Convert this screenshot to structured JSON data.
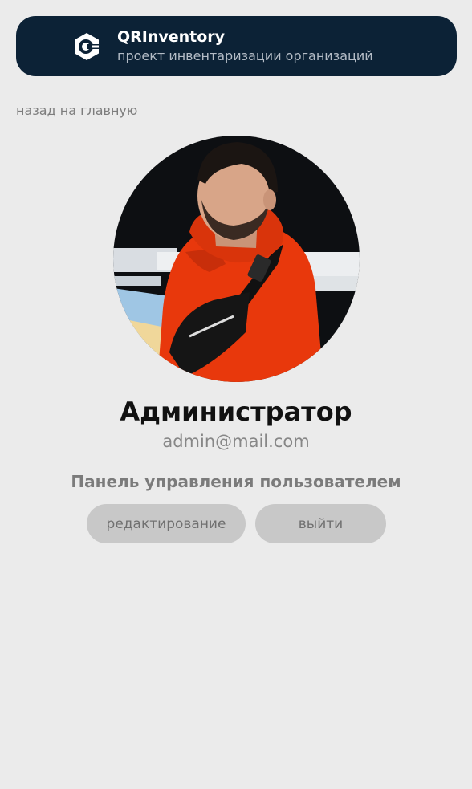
{
  "header": {
    "title": "QRInventory",
    "subtitle": "проект инвентаризации организаций",
    "logo_icon": "qr-gear-logo-icon",
    "background": "#0c2236"
  },
  "nav": {
    "back_label": "назад на главную"
  },
  "profile": {
    "name": "Администратор",
    "email": "admin@mail.com",
    "avatar": "user-photo-avatar"
  },
  "panel": {
    "title": "Панель управления пользователем",
    "edit_label": "редактирование",
    "logout_label": "выйти"
  },
  "colors": {
    "page_bg": "#ebebeb",
    "button_bg": "#c8c8c8",
    "hoodie": "#e8380c"
  }
}
